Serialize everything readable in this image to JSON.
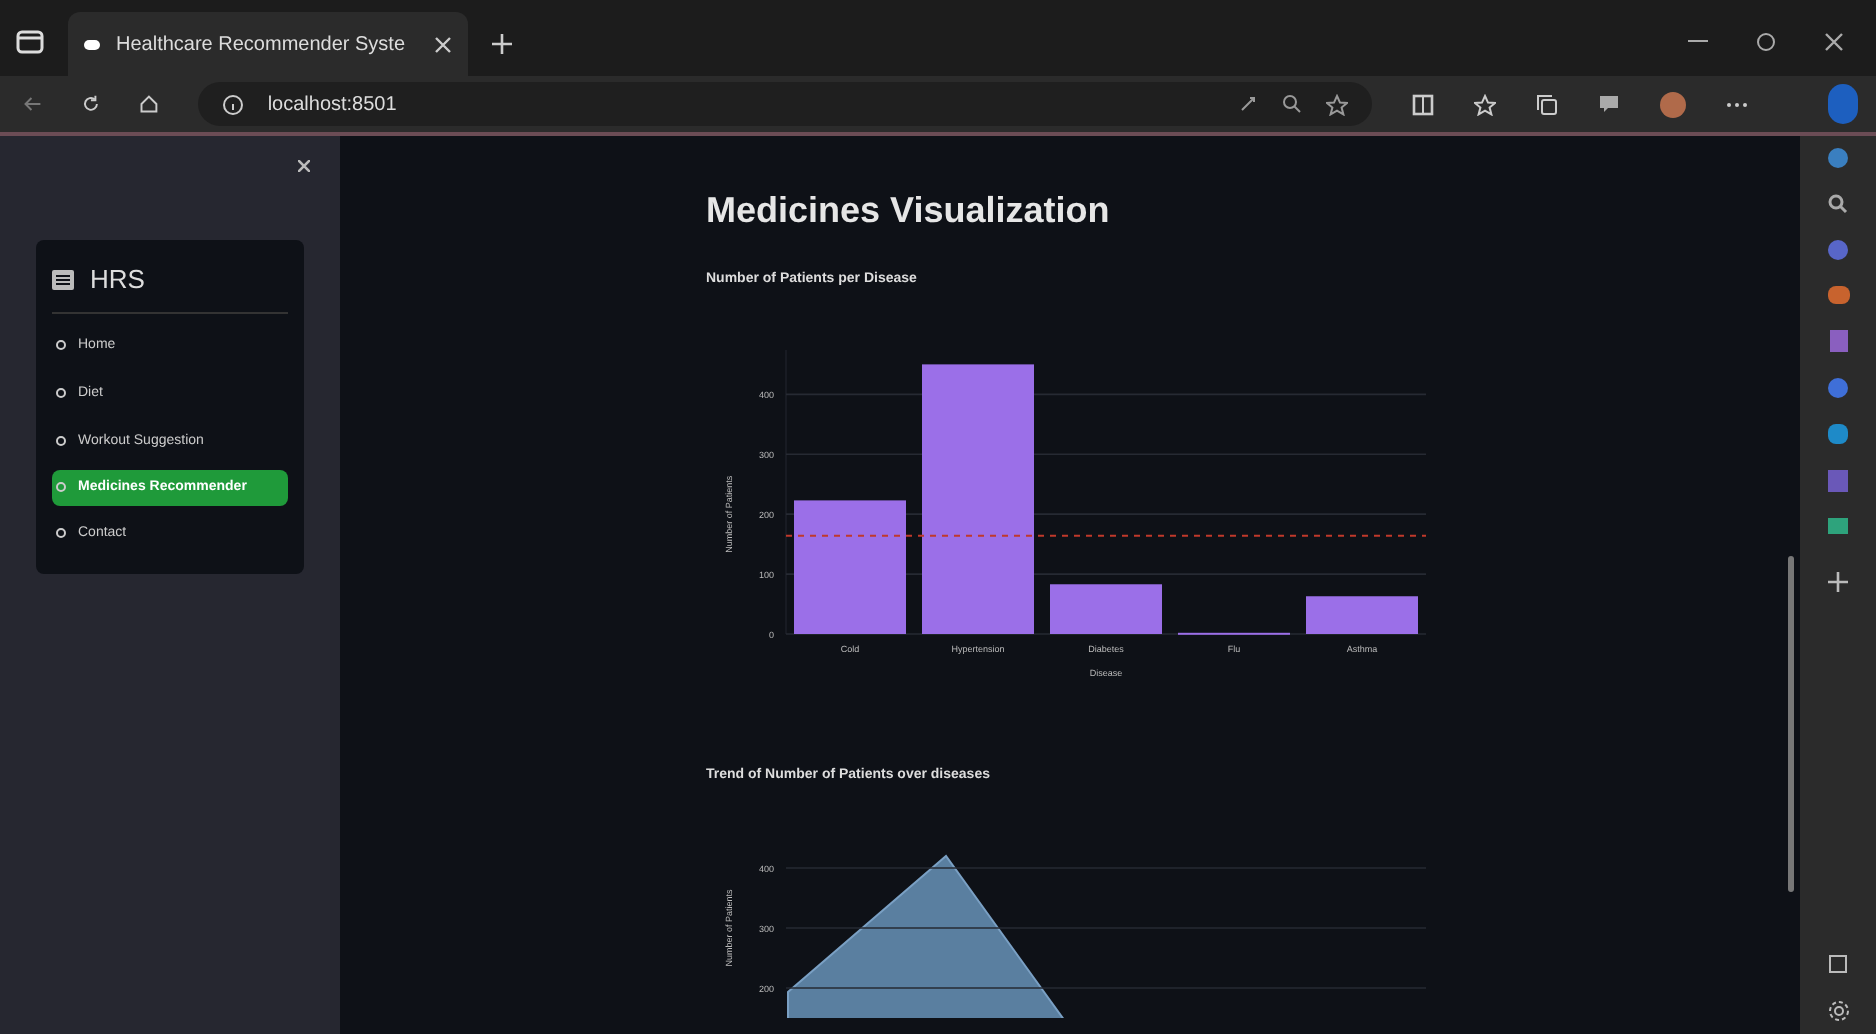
{
  "browser": {
    "tab_title": "Healthcare Recommender Syste",
    "url": "localhost:8501"
  },
  "sidebar": {
    "title": "HRS",
    "items": [
      {
        "label": "Home",
        "selected": false
      },
      {
        "label": "Diet",
        "selected": false
      },
      {
        "label": "Workout Suggestion",
        "selected": false
      },
      {
        "label": "Medicines Recommender",
        "selected": true
      },
      {
        "label": "Contact",
        "selected": false
      }
    ]
  },
  "main": {
    "heading": "Medicines Visualization",
    "charts": [
      {
        "chart_data": {
          "type": "bar",
          "title": "Number of Patients per Disease",
          "xlabel": "Disease",
          "ylabel": "Number of Patients",
          "categories": [
            "Cold",
            "Hypertension",
            "Diabetes",
            "Flu",
            "Asthma"
          ],
          "series": [
            {
              "color": "#9b6fe8",
              "values": [
                223,
                450,
                83,
                2,
                63
              ]
            }
          ],
          "ylim": [
            0,
            474
          ],
          "yticks": [
            0,
            100,
            200,
            300,
            400
          ],
          "grid": true,
          "ref_lines": [
            {
              "axis": "y",
              "value": 164
            }
          ]
        }
      },
      {
        "picture": {
          "title": "Trend of Number of Patients over diseases",
          "ylabel": "Number of Patients",
          "y_axis_labels": [
            "400",
            "300",
            "200"
          ]
        }
      }
    ]
  }
}
